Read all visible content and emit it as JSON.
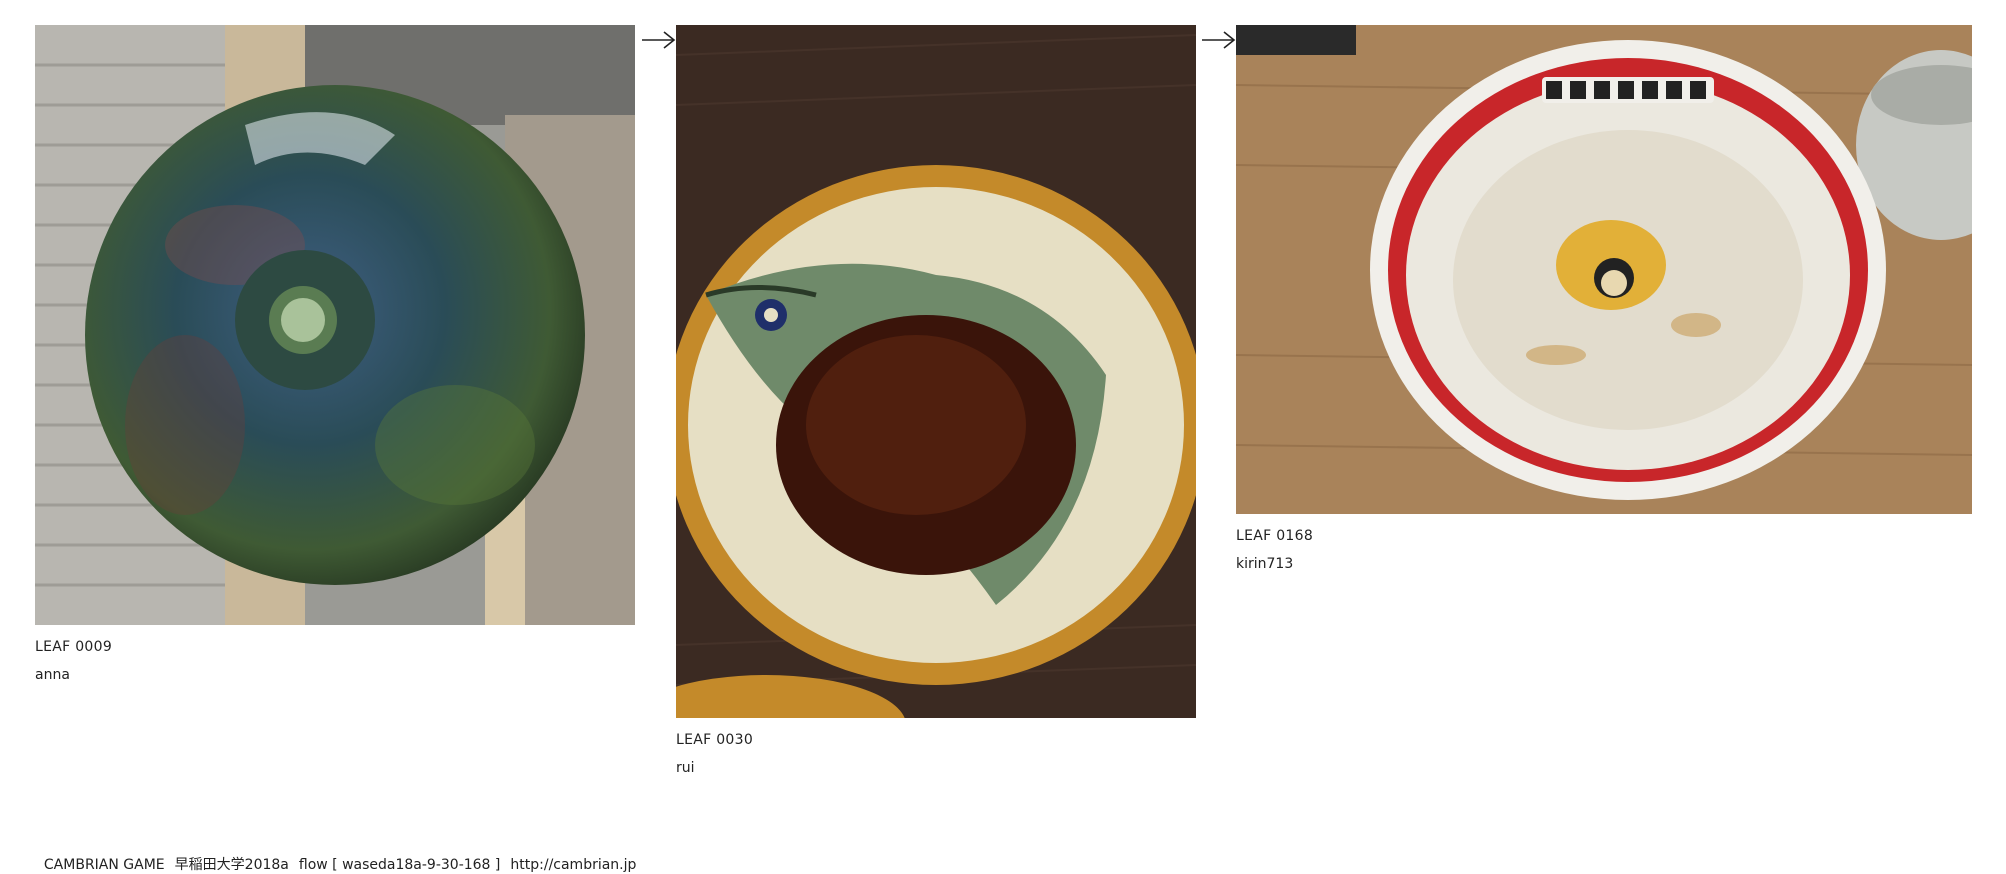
{
  "leaves": [
    {
      "id": "LEAF 0009",
      "author": "anna",
      "photo_icon": "glazed-vase-top-view-photo"
    },
    {
      "id": "LEAF 0030",
      "author": "rui",
      "photo_icon": "fish-painted-plate-photo"
    },
    {
      "id": "LEAF 0168",
      "author": "kirin713",
      "photo_icon": "ramen-bowl-photo"
    }
  ],
  "arrows": [
    "arrow-right-icon",
    "arrow-right-icon"
  ],
  "footer": {
    "brand": "CAMBRIAN GAME",
    "session": "早稲田大学2018a",
    "flow": "flow [ waseda18a-9-30-168 ]",
    "url": "http://cambrian.jp"
  },
  "colors": {
    "background": "#ffffff",
    "text": "#222222"
  }
}
